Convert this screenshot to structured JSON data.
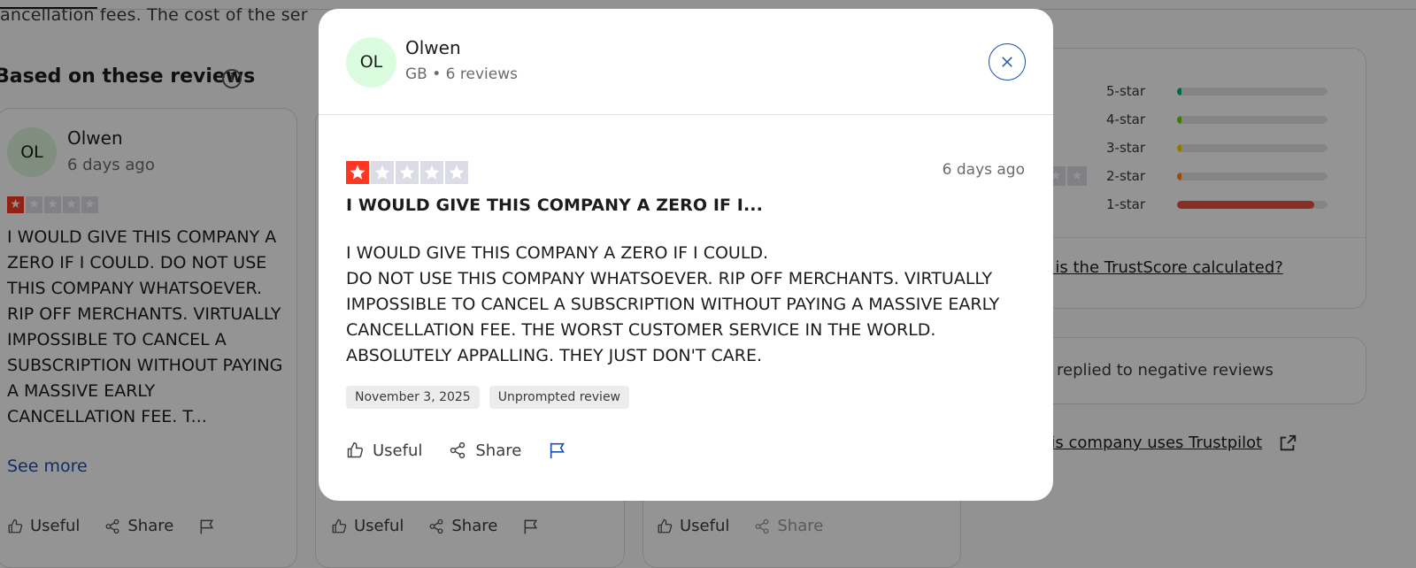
{
  "background": {
    "intro_text": "ancellation fees. The cost of the ser",
    "section_title": "Based on these reviews",
    "card_review": {
      "avatar_initials": "OL",
      "name": "Olwen",
      "date": "6 days ago",
      "body": "I WOULD GIVE THIS COMPANY A ZERO IF I COULD. DO NOT USE THIS COMPANY WHATSOEVER. RIP OFF MERCHANTS. VIRTUALLY IMPOSSIBLE TO CANCEL A SUBSCRIPTION WITHOUT PAYING A MASSIVE EARLY CANCELLATION FEE. T...",
      "see_more": "See more",
      "rating": 1
    },
    "card_actions": {
      "useful_label": "Useful",
      "share_label": "Share"
    },
    "rating_distribution": {
      "rows": [
        {
          "label": "5-star",
          "fraction": 0.02,
          "color": "#00b67a"
        },
        {
          "label": "4-star",
          "fraction": 0.01,
          "color": "#73cf11"
        },
        {
          "label": "3-star",
          "fraction": 0.01,
          "color": "#ffce00"
        },
        {
          "label": "2-star",
          "fraction": 0.03,
          "color": "#ff8622"
        },
        {
          "label": "1-star",
          "fraction": 0.91,
          "color": "#e8523e"
        }
      ],
      "trustscore_link": "v is the TrustScore calculated?"
    },
    "reply_text": "replied to negative reviews",
    "uses_link": "his company uses Trustpilot"
  },
  "modal": {
    "consumer": {
      "avatar_initials": "OL",
      "name": "Olwen",
      "meta": "GB • 6 reviews"
    },
    "review": {
      "rating": 1,
      "date": "6 days ago",
      "title": "I WOULD GIVE THIS COMPANY A ZERO IF I...",
      "body_line_1": "I WOULD GIVE THIS COMPANY A ZERO IF I COULD.",
      "body_line_2": "DO NOT USE THIS COMPANY WHATSOEVER. RIP OFF MERCHANTS. VIRTUALLY IMPOSSIBLE TO CANCEL A SUBSCRIPTION WITHOUT PAYING A MASSIVE EARLY CANCELLATION FEE. THE WORST CUSTOMER SERVICE IN THE WORLD. ABSOLUTELY APPALLING. THEY JUST DON'T CARE.",
      "experience_date": "November 3, 2025",
      "review_type": "Unprompted review"
    },
    "actions": {
      "useful_label": "Useful",
      "share_label": "Share"
    },
    "colors": {
      "star_active": "#ff3722",
      "star_inactive": "#dcdce6",
      "link_blue": "#1a50b0"
    },
    "icons": [
      "close-icon",
      "thumbs-up-icon",
      "share-icon",
      "flag-icon",
      "star-icon"
    ]
  }
}
